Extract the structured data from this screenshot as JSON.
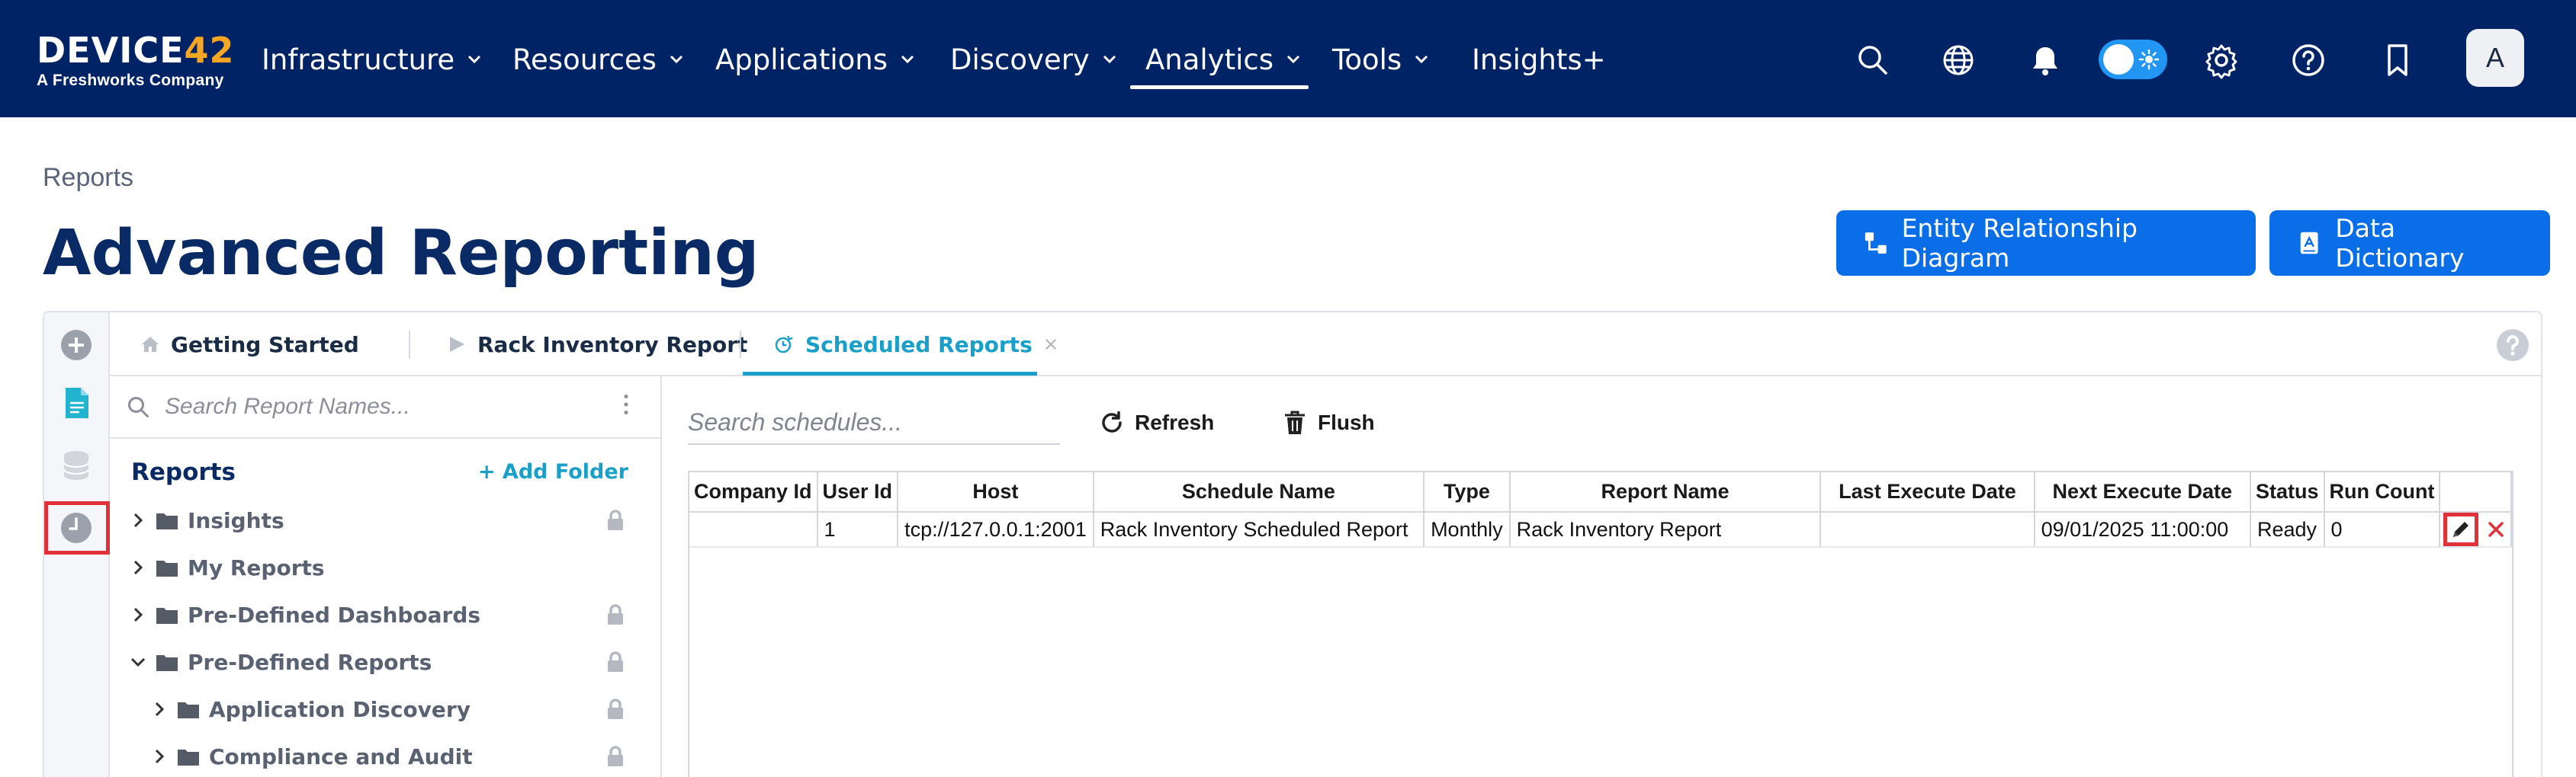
{
  "brand": {
    "logo_text": "DEVICE",
    "logo_num": "42",
    "tagline": "A Freshworks Company"
  },
  "nav": {
    "items": [
      {
        "label": "Infrastructure",
        "has_dropdown": true
      },
      {
        "label": "Resources",
        "has_dropdown": true
      },
      {
        "label": "Applications",
        "has_dropdown": true
      },
      {
        "label": "Discovery",
        "has_dropdown": true
      },
      {
        "label": "Analytics",
        "has_dropdown": true,
        "active": true
      },
      {
        "label": "Tools",
        "has_dropdown": true
      },
      {
        "label": "Insights+",
        "has_dropdown": false
      }
    ],
    "icons": [
      "search-icon",
      "globe-icon",
      "bell-icon",
      "theme-toggle",
      "gear-icon",
      "help-icon",
      "bookmark-icon"
    ],
    "avatar_initial": "A"
  },
  "page": {
    "breadcrumb": "Reports",
    "title": "Advanced Reporting",
    "buttons": {
      "erd": "Entity Relationship Diagram",
      "dictionary": "Data Dictionary"
    }
  },
  "tabs": [
    {
      "label": "Getting Started",
      "icon": "home-icon"
    },
    {
      "label": "Rack Inventory Report",
      "icon": "play-icon"
    },
    {
      "label": "Scheduled Reports",
      "icon": "schedule-icon",
      "active": true,
      "closable": true
    }
  ],
  "tree": {
    "search_placeholder": "Search Report Names...",
    "header": "Reports",
    "add_folder": "+ Add Folder",
    "items": [
      {
        "label": "Insights",
        "expanded": false,
        "locked": true,
        "level": 0
      },
      {
        "label": "My Reports",
        "expanded": false,
        "locked": false,
        "level": 0
      },
      {
        "label": "Pre-Defined Dashboards",
        "expanded": false,
        "locked": true,
        "level": 0
      },
      {
        "label": "Pre-Defined Reports",
        "expanded": true,
        "locked": true,
        "level": 0
      },
      {
        "label": "Application Discovery",
        "expanded": false,
        "locked": true,
        "level": 1
      },
      {
        "label": "Compliance and Audit",
        "expanded": false,
        "locked": true,
        "level": 1
      }
    ]
  },
  "schedules": {
    "search_placeholder": "Search schedules...",
    "refresh_label": "Refresh",
    "flush_label": "Flush",
    "columns": [
      "Company Id",
      "User Id",
      "Host",
      "Schedule Name",
      "Type",
      "Report Name",
      "Last Execute Date",
      "Next Execute Date",
      "Status",
      "Run Count"
    ],
    "rows": [
      [
        "",
        "1",
        "tcp://127.0.0.1:2001",
        "Rack Inventory Scheduled Report",
        "Monthly",
        "Rack Inventory Report",
        "",
        "09/01/2025 11:00:00",
        "Ready",
        "0"
      ]
    ]
  },
  "colors": {
    "navbar": "#002366",
    "primary": "#0a6ee8",
    "accent": "#1aa0c8",
    "highlight": "#e0303a",
    "title": "#0a2a66"
  }
}
